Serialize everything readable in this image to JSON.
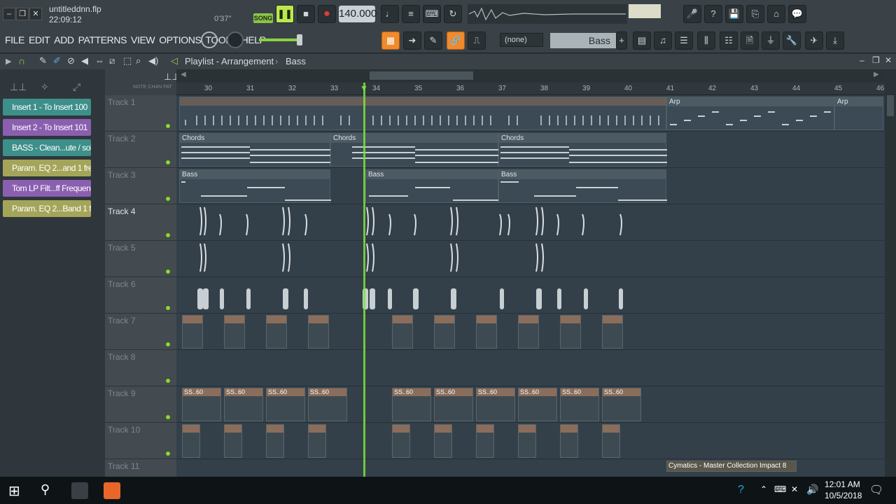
{
  "window": {
    "filename": "untitleddnn.flp",
    "time_display": "22:09:12",
    "pos_display": "0'37\"",
    "song_mode": "SONG",
    "tempo": "140.000"
  },
  "menu": [
    "FILE",
    "EDIT",
    "ADD",
    "PATTERNS",
    "VIEW",
    "OPTIONS",
    "TOOLS",
    "HELP"
  ],
  "toolbar": {
    "pattern_select": "(none)",
    "channel_name": "Bass"
  },
  "playlist": {
    "title": "Playlist - Arrangement",
    "breadcrumb": "Bass"
  },
  "automation": [
    {
      "label": "Insert 1 - To Insert 100",
      "color": "teal"
    },
    {
      "label": "Insert 2 - To Insert 101",
      "color": "purple"
    },
    {
      "label": "BASS - Clean...ute / solo",
      "color": "teal"
    },
    {
      "label": "Param. EQ 2...and 1 freq",
      "color": "olive"
    },
    {
      "label": "Tom LP Filt...ff Frequency",
      "color": "purple"
    },
    {
      "label": "Param. EQ 2...Band 1 freq",
      "color": "olive"
    }
  ],
  "ruler": [
    "30",
    "31",
    "32",
    "33",
    "34",
    "35",
    "36",
    "37",
    "38",
    "39",
    "40",
    "41",
    "42",
    "43",
    "44",
    "45",
    "46"
  ],
  "tracks": [
    "Track 1",
    "Track 2",
    "Track 3",
    "Track 4",
    "Track 5",
    "Track 6",
    "Track 7",
    "Track 8",
    "Track 9",
    "Track 10",
    "Track 11"
  ],
  "clips": {
    "arp": "Arp",
    "chords": "Chords",
    "bass": "Bass",
    "ss60": "SS..60",
    "cymatics": "Cymatics - Master Collection Impact 8"
  },
  "taskbar": {
    "time": "12:01 AM",
    "date": "10/5/2018"
  }
}
